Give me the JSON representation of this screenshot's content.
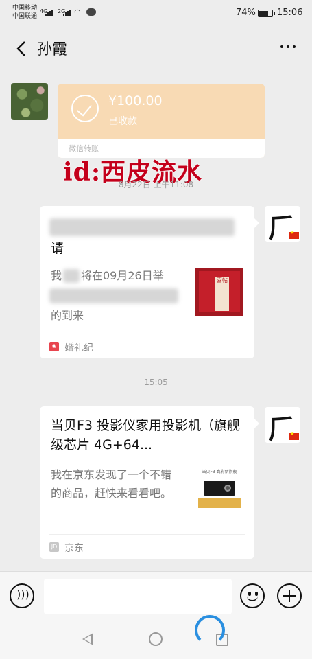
{
  "status_bar": {
    "carrier_1": "中国移动",
    "carrier_2": "中国联通",
    "signal_1_label": "4G",
    "signal_2_label": "2G",
    "battery_percent": "74%",
    "battery_level": 0.74,
    "time": "15:06"
  },
  "header": {
    "back_icon": "chevron-left-icon",
    "contact_name": "孙霞",
    "more_icon": "more-dots-icon"
  },
  "messages": {
    "transfer": {
      "amount": "¥100.00",
      "status": "已收款",
      "label": "微信转账",
      "color": "#f8dab4"
    },
    "watermark": "id:西皮流水",
    "timestamp_1": "8月22日 上午11:08",
    "wedding_card": {
      "title_visible": "请",
      "desc_line_1": "我",
      "desc_line_1b": "将在09月26日举",
      "desc_line_3": "的到来",
      "thumb_text": "喜帖",
      "source_label": "婚礼纪",
      "source_color": "#e8454f"
    },
    "timestamp_2": "15:05",
    "product_card": {
      "title": "当贝F3 投影仪家用投影机（旗舰级芯片 4G+64...",
      "description": "我在京东发现了一个不错的商品，赶快来看看吧。",
      "thumb_caption": "当贝F3 真彩新旗舰",
      "source_label": "京东",
      "source_icon_text": "JD"
    }
  },
  "input_bar": {
    "voice_icon": "voice-icon",
    "text_value": "",
    "emoji_icon": "emoji-icon",
    "plus_icon": "plus-icon"
  },
  "system_nav": {
    "back_icon": "nav-back-icon",
    "home_icon": "nav-home-icon",
    "recent_icon": "nav-recent-icon"
  }
}
